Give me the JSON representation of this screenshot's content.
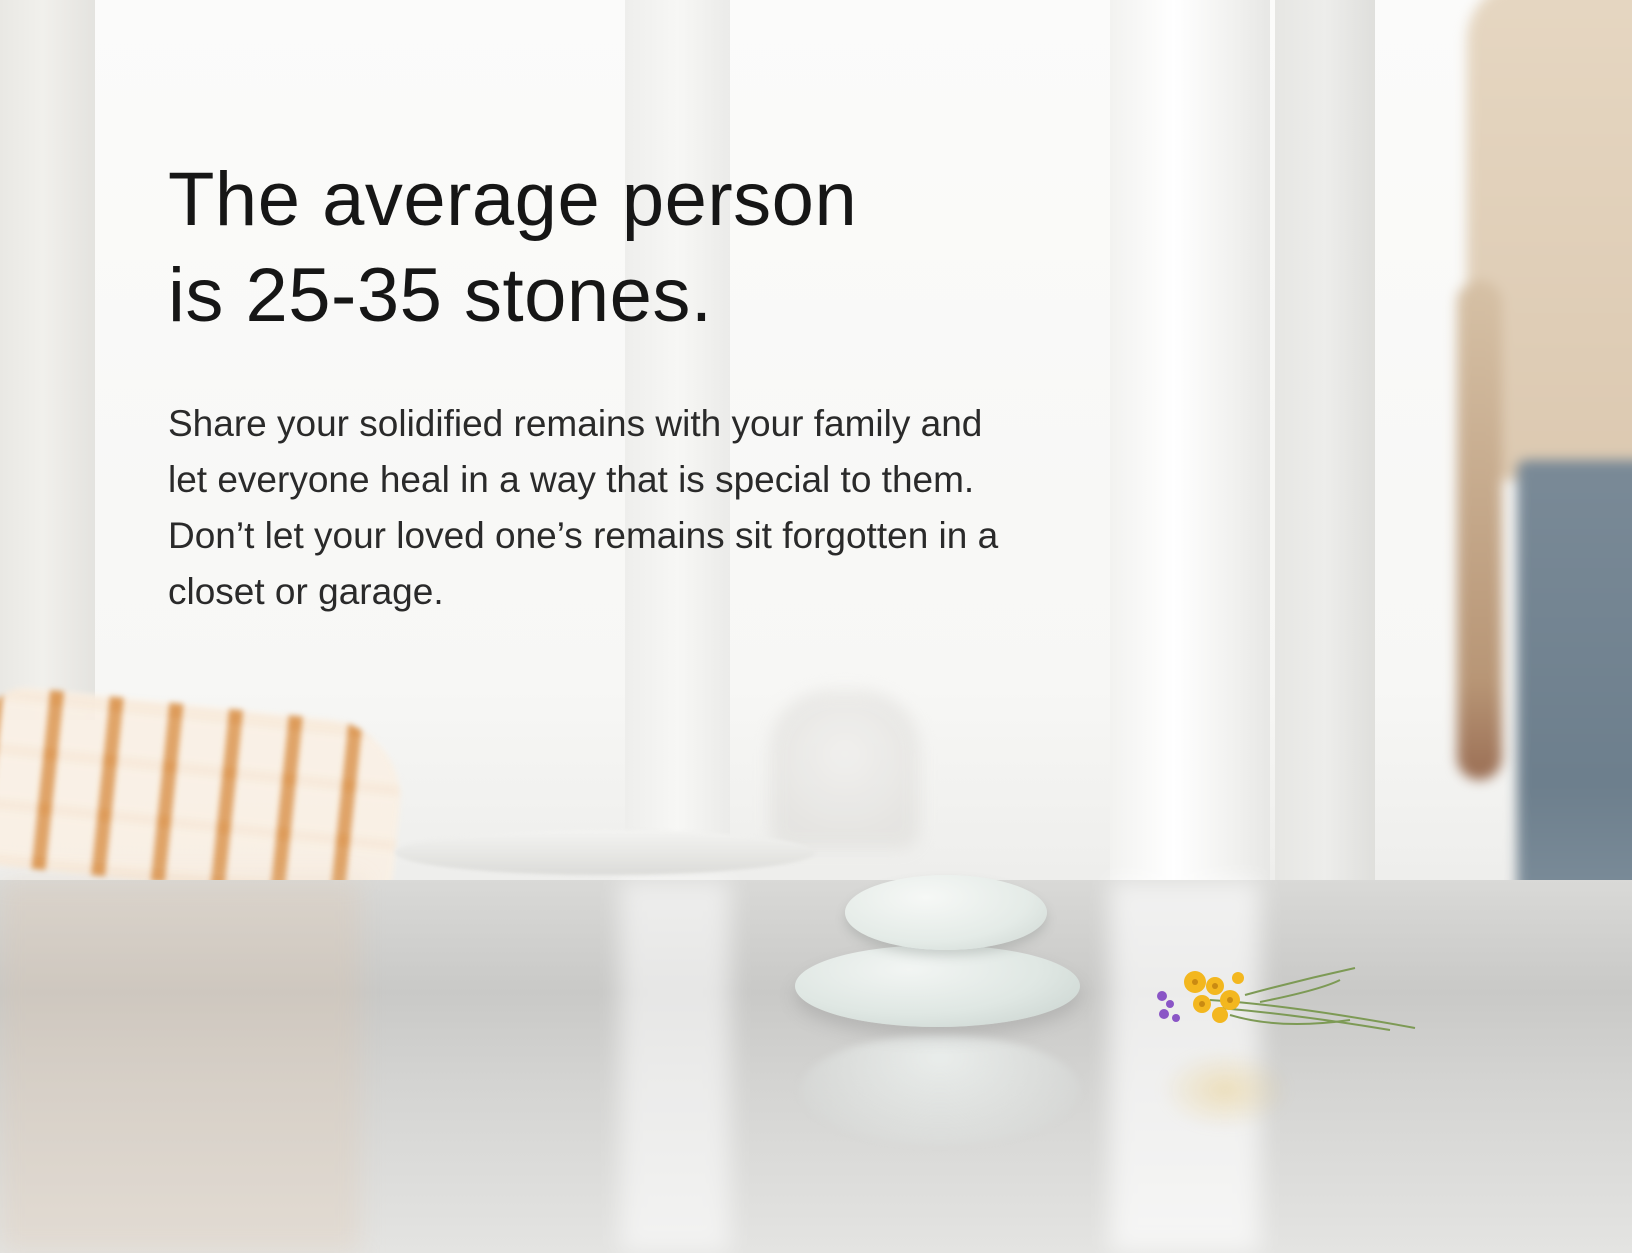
{
  "headline": {
    "line1": "The average person",
    "line2": "is 25-35 stones."
  },
  "body": {
    "lines": [
      "Share your solidified remains with your family and",
      "let everyone heal in a way that is special to them.",
      "Don’t let your loved one’s remains sit forgotten in a",
      "closet or garage."
    ]
  },
  "colors": {
    "text": "#161616",
    "stone": "#e4ebe7",
    "flower_yellow": "#f3b71f",
    "flower_purple": "#8a55c6"
  },
  "icons": [
    "stacked-stones-image",
    "wildflowers-image",
    "checked-towel-image",
    "person-silhouette-image"
  ]
}
